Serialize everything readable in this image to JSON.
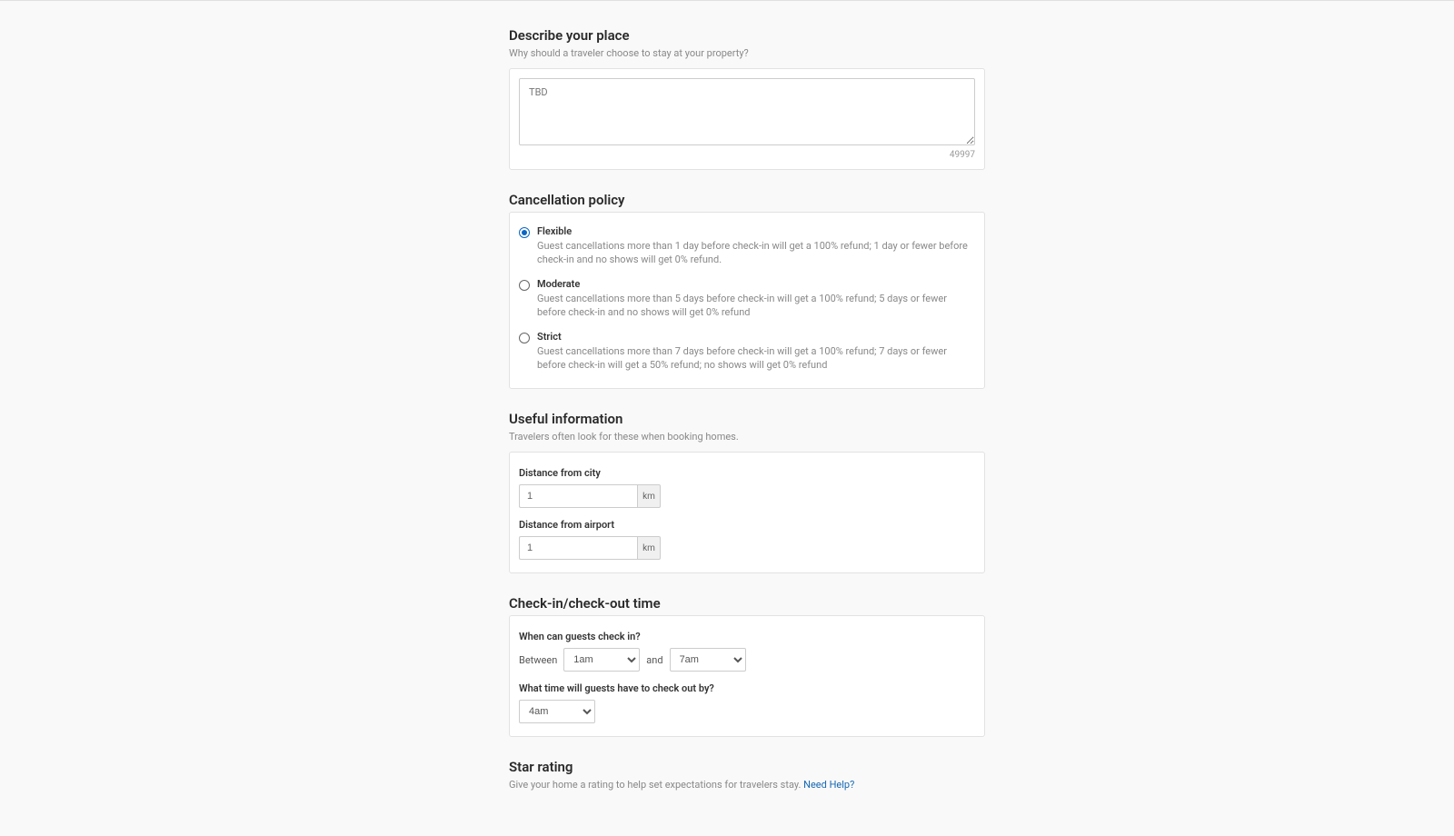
{
  "describe": {
    "title": "Describe your place",
    "sub": "Why should a traveler choose to stay at your property?",
    "value": "TBD",
    "charcount": "49997"
  },
  "cancellation": {
    "title": "Cancellation policy",
    "options": [
      {
        "label": "Flexible",
        "desc": "Guest cancellations more than 1 day before check-in will get a 100% refund; 1 day or fewer before check-in and no shows will get 0% refund.",
        "selected": true
      },
      {
        "label": "Moderate",
        "desc": "Guest cancellations more than 5 days before check-in will get a 100% refund; 5 days or fewer before check-in and no shows will get 0% refund",
        "selected": false
      },
      {
        "label": "Strict",
        "desc": "Guest cancellations more than 7 days before check-in will get a 100% refund; 7 days or fewer before check-in will get a 50% refund; no shows will get 0% refund",
        "selected": false
      }
    ]
  },
  "useful": {
    "title": "Useful information",
    "sub": "Travelers often look for these when booking homes.",
    "distance_city_label": "Distance from city",
    "distance_city_value": "1",
    "distance_airport_label": "Distance from airport",
    "distance_airport_value": "1",
    "unit": "km"
  },
  "checktime": {
    "title": "Check-in/check-out time",
    "checkin_label": "When can guests check in?",
    "between_label": "Between",
    "and_label": "and",
    "checkin_from": "1am",
    "checkin_to": "7am",
    "checkout_label": "What time will guests have to check out by?",
    "checkout_value": "4am"
  },
  "star": {
    "title": "Star rating",
    "sub": "Give your home a rating to help set expectations for travelers stay.",
    "help_link": "Need Help?"
  }
}
